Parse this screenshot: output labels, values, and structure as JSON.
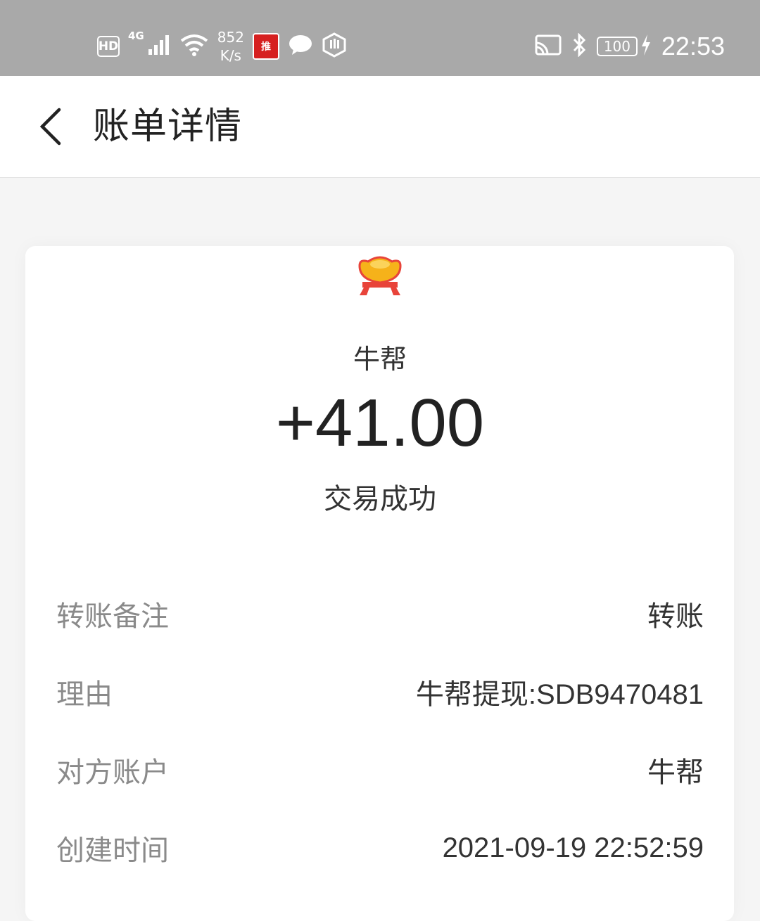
{
  "status_bar": {
    "hd": "HD",
    "network": "4G",
    "speed_value": "852",
    "speed_unit": "K/s",
    "app_badge": "推",
    "battery": "100",
    "time": "22:53"
  },
  "header": {
    "title": "账单详情"
  },
  "transaction": {
    "merchant": "牛帮",
    "amount": "+41.00",
    "status": "交易成功",
    "details": [
      {
        "label": "转账备注",
        "value": "转账"
      },
      {
        "label": "理由",
        "value": "牛帮提现:SDB9470481"
      },
      {
        "label": "对方账户",
        "value": "牛帮"
      },
      {
        "label": "创建时间",
        "value": "2021-09-19 22:52:59"
      }
    ]
  },
  "icons": {
    "back": "chevron-left-icon",
    "logo": "gold-ingot-icon"
  },
  "colors": {
    "status_bar": "#a9a9a9",
    "background": "#f5f5f5",
    "label": "#8a8a8a",
    "logo_gold": "#f6b21a",
    "logo_red": "#e8443a"
  }
}
